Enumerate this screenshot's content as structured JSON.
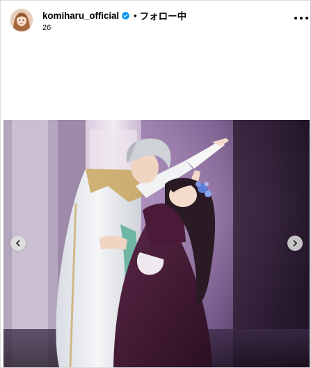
{
  "post": {
    "username": "komiharu_official",
    "verified": true,
    "separator": "•",
    "follow_label": "フォロー中",
    "subtext": "26",
    "more_icon": "more-horizontal-icon",
    "avatar_icon": "profile-avatar"
  },
  "carousel": {
    "prev_icon": "chevron-left-icon",
    "next_icon": "chevron-right-icon"
  },
  "colors": {
    "verified_blue": "#0095f6",
    "stage_purple": "#8a6aa0",
    "dress_plum": "#4a1f3a",
    "cape_white": "#eef0f3"
  }
}
